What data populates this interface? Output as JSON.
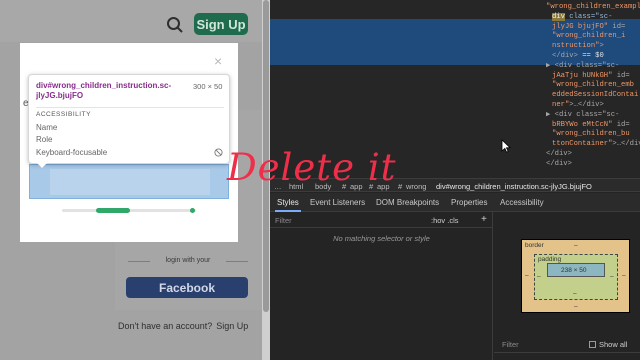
{
  "page": {
    "signup_label": "Sign Up",
    "login_with": "login with your",
    "facebook_label": "Facebook",
    "no_account_text": "Don't have an account?",
    "no_account_link": "Sign Up",
    "modal_letter": "e",
    "modal_close": "×"
  },
  "tooltip": {
    "selector": "div#wrong_children_instruction.sc-jlyJG.bjujFO",
    "size": "300 × 50",
    "heading": "ACCESSIBILITY",
    "rows": [
      "Name",
      "Role",
      "Keyboard-focusable"
    ]
  },
  "devtools": {
    "dom_lines": [
      {
        "a": "\"wrong_children_examples\"",
        "b": ">…</div>"
      },
      {
        "a": "div",
        "b": " class=\"sc-"
      },
      {
        "a": "jlyJG bjujFO\"",
        "b": " id="
      },
      {
        "a": "\"wrong_children_i",
        "b": ""
      },
      {
        "a": "nstruction\"",
        "b": ">"
      },
      {
        "a": "</div>",
        "b": " == $0"
      },
      {
        "a": "▶ <div class=\"sc-",
        "b": ""
      },
      {
        "a": "jAaTju hUNkGH\"",
        "b": " id="
      },
      {
        "a": "\"wrong_children_emb",
        "b": ""
      },
      {
        "a": "eddedSessionIdContai",
        "b": ""
      },
      {
        "a": "ner\"",
        "b": ">…</div>"
      },
      {
        "a": "▶ <div class=\"sc-",
        "b": ""
      },
      {
        "a": "bRBYWo eMtCcN\"",
        "b": " id="
      },
      {
        "a": "\"wrong_children_bu",
        "b": ""
      },
      {
        "a": "ttonContainer\"",
        "b": ">…</div>"
      },
      {
        "a": "</div>",
        "b": ""
      },
      {
        "a": "</div>",
        "b": ""
      }
    ],
    "breadcrumb": [
      "…",
      "html",
      "body",
      "#",
      "app",
      "#",
      "app",
      "#",
      "wrong",
      "div#wrong_children_instruction.sc-jlyJG.bjujFO"
    ],
    "tabs": [
      "Styles",
      "Event Listeners",
      "DOM Breakpoints",
      "Properties",
      "Accessibility"
    ],
    "styles_filter": "Filter",
    "styles_hov": ":hov  .cls",
    "styles_plus": "+",
    "no_match": "No matching selector or style",
    "box": {
      "border": "border",
      "border_dash": "–",
      "padding": "padding",
      "padding_dash": "–",
      "content": "238 × 50",
      "side_dash": "–"
    },
    "box_filter": "Filter",
    "show_all": "Show all"
  },
  "overlay": "Delete it",
  "colors": {
    "accent_green": "#1f6b4d",
    "facebook_blue": "#29406e",
    "overlay_red": "#ef2f4a",
    "devtools_selected": "#1f4a7c"
  }
}
